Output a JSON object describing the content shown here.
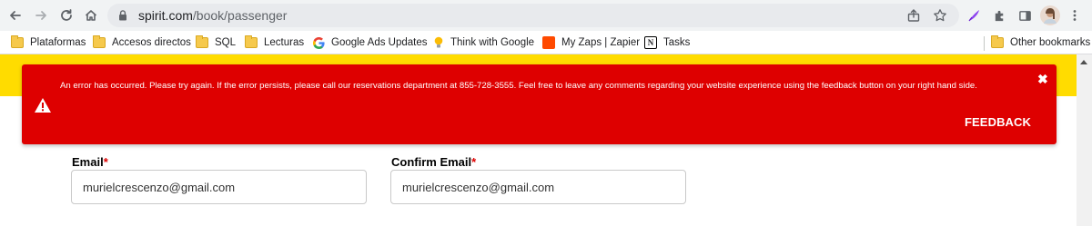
{
  "browser": {
    "url_domain": "spirit.com",
    "url_path": "/book/passenger"
  },
  "bookmarks": [
    {
      "label": "Plataformas",
      "icon": "folder-icon"
    },
    {
      "label": "Accesos directos",
      "icon": "folder-icon"
    },
    {
      "label": "SQL",
      "icon": "folder-icon"
    },
    {
      "label": "Lecturas",
      "icon": "folder-icon"
    },
    {
      "label": "Google Ads Updates",
      "icon": "google-icon"
    },
    {
      "label": "Think with Google",
      "icon": "lightbulb-icon"
    },
    {
      "label": "My Zaps | Zapier",
      "icon": "zapier-icon"
    },
    {
      "label": "Tasks",
      "icon": "notion-icon"
    }
  ],
  "other_bookmarks": "Other bookmarks",
  "error_banner": {
    "message": "An error has occurred. Please try again. If the error persists, please call our reservations department at 855-728-3555. Feel free to leave any comments regarding your website experience using the feedback button on your right hand side.",
    "close_glyph": "✖",
    "feedback_label": "FEEDBACK",
    "background": "#de0000"
  },
  "form": {
    "email_label": "Email",
    "confirm_email_label": "Confirm Email",
    "required_marker": "*",
    "email_value": "murielcrescenzo@gmail.com",
    "confirm_email_value": "murielcrescenzo@gmail.com"
  },
  "colors": {
    "brand_yellow": "#ffdc00",
    "error_red": "#de0000"
  }
}
